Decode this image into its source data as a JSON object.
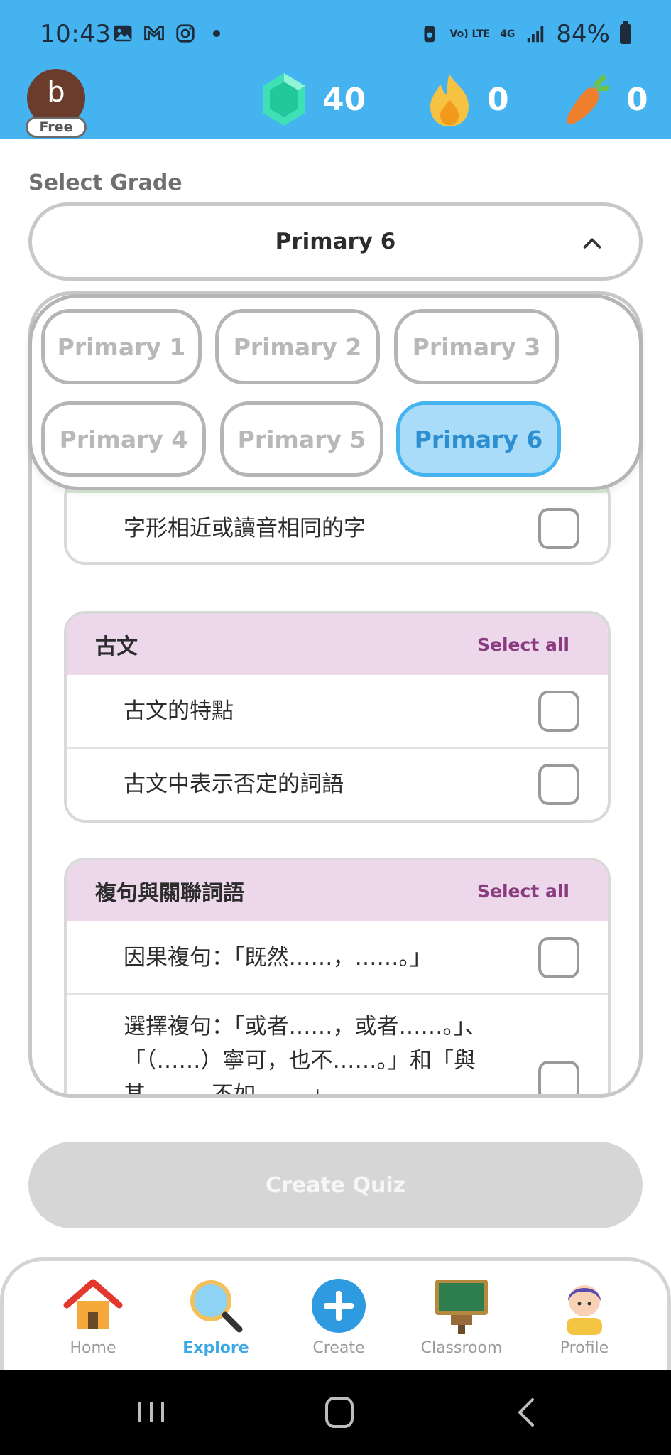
{
  "status_bar": {
    "time": "10:43",
    "network_top": "Vo) LTE",
    "network_4g": "4G",
    "battery": "84%"
  },
  "header": {
    "avatar_letter": "b",
    "plan_badge": "Free",
    "gems": "40",
    "streak": "0",
    "carrots": "0"
  },
  "grade": {
    "label": "Select Grade",
    "selected": "Primary 6",
    "options": [
      "Primary 1",
      "Primary 2",
      "Primary 3",
      "Primary 4",
      "Primary 5",
      "Primary 6"
    ]
  },
  "topics": {
    "card1": {
      "rows": [
        "字形相近或讀音相同的字"
      ]
    },
    "card2": {
      "title": "古文",
      "select_all": "Select all",
      "rows": [
        "古文的特點",
        "古文中表示否定的詞語"
      ]
    },
    "card3": {
      "title": "複句與關聯詞語",
      "select_all": "Select all",
      "rows": [
        "因果複句：「既然……，……。」",
        "選擇複句：「或者……，或者……。」、「（……）寧可，也不……。」和「與其……，不如……。」"
      ]
    }
  },
  "actions": {
    "create_quiz": "Create Quiz"
  },
  "bottom_nav": {
    "items": [
      "Home",
      "Explore",
      "Create",
      "Classroom",
      "Profile"
    ],
    "active": "Explore"
  },
  "colors": {
    "header_blue": "#44b3ef",
    "topic_header": "#ecd8ea",
    "select_all": "#8a3b80",
    "selected_grade": "#a8dcf8"
  }
}
